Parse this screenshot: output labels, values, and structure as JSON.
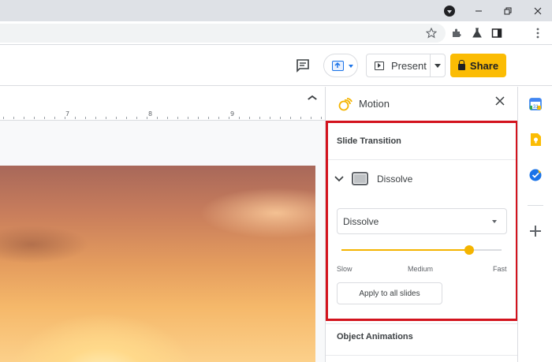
{
  "browser": {
    "icons": [
      "profile-dropdown-icon",
      "minimize-icon",
      "restore-icon",
      "close-icon",
      "star-icon",
      "extensions-icon",
      "labs-icon",
      "side-panel-icon",
      "more-icon"
    ]
  },
  "header": {
    "present_label": "Present",
    "share_label": "Share"
  },
  "ruler": {
    "numbers": [
      "7",
      "8",
      "9"
    ]
  },
  "motion_panel": {
    "title": "Motion",
    "slide_transition_heading": "Slide Transition",
    "transition_name": "Dissolve",
    "transition_select_value": "Dissolve",
    "speed": {
      "level": 0.8,
      "labels": [
        "Slow",
        "Medium",
        "Fast"
      ]
    },
    "apply_all_label": "Apply to all slides",
    "object_animations_heading": "Object Animations"
  },
  "side_panel": {
    "icons": [
      "calendar-icon",
      "keep-icon",
      "tasks-icon",
      "add-icon"
    ]
  },
  "colors": {
    "accent_yellow": "#fbbc04",
    "slider_yellow": "#f4b400",
    "highlight_red": "#d3131d",
    "google_blue": "#1a73e8"
  }
}
